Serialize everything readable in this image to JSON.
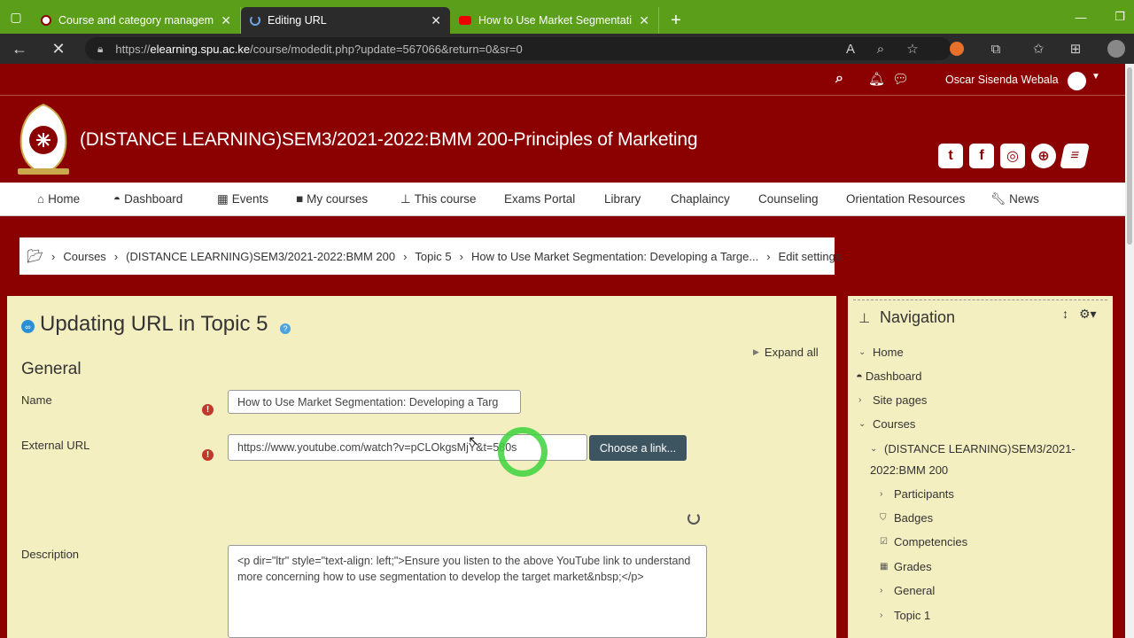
{
  "browser": {
    "tabs": [
      {
        "label": "Course and category manageme",
        "icon": "spu-favicon"
      },
      {
        "label": "Editing URL",
        "icon": "loading-icon"
      },
      {
        "label": "How to Use Market Segmentatio",
        "icon": "youtube-icon"
      }
    ],
    "url_prefix": "https://",
    "url_domain": "elearning.spu.ac.ke",
    "url_path": "/course/modedit.php?update=567066&return=0&sr=0"
  },
  "topnav": {
    "user_name": "Oscar Sisenda Webala"
  },
  "header": {
    "course_title": "(DISTANCE LEARNING)SEM3/2021-2022:BMM 200-Principles of Marketing"
  },
  "menu": [
    {
      "label": "Home",
      "icon": "home-icon"
    },
    {
      "label": "Dashboard",
      "icon": "dashboard-icon"
    },
    {
      "label": "Events",
      "icon": "calendar-icon"
    },
    {
      "label": "My courses",
      "icon": "briefcase-icon"
    },
    {
      "label": "This course",
      "icon": "sitemap-icon"
    },
    {
      "label": "Exams Portal"
    },
    {
      "label": "Library"
    },
    {
      "label": "Chaplaincy"
    },
    {
      "label": "Counseling"
    },
    {
      "label": "Orientation Resources"
    },
    {
      "label": "News",
      "icon": "wrench-icon"
    }
  ],
  "breadcrumb": [
    "Courses",
    "(DISTANCE LEARNING)SEM3/2021-2022:BMM 200",
    "Topic 5",
    "How to Use Market Segmentation: Developing a Targe...",
    "Edit settings"
  ],
  "form": {
    "page_heading": "Updating URL in Topic 5",
    "expand_all": "Expand all",
    "section_general": "General",
    "name_label": "Name",
    "name_value": "How to Use Market Segmentation: Developing a Targ",
    "url_label": "External URL",
    "url_value": "https://www.youtube.com/watch?v=pCLOkgsMjY&t=580s",
    "choose_link": "Choose a link...",
    "description_label": "Description",
    "description_value": "<p dir=\"ltr\" style=\"text-align: left;\">Ensure you listen to the above YouTube link to understand more concerning how to use segmentation to develop the target market&nbsp;</p>"
  },
  "navigation": {
    "title": "Navigation",
    "items": [
      {
        "label": "Home"
      },
      {
        "label": "Dashboard"
      },
      {
        "label": "Site pages"
      },
      {
        "label": "Courses"
      },
      {
        "label": "(DISTANCE LEARNING)SEM3/2021-"
      },
      {
        "label": "2022:BMM 200"
      },
      {
        "label": "Participants"
      },
      {
        "label": "Badges"
      },
      {
        "label": "Competencies"
      },
      {
        "label": "Grades"
      },
      {
        "label": "General"
      },
      {
        "label": "Topic 1"
      }
    ]
  },
  "colors": {
    "brand": "#8b0000",
    "tabbar": "#5a9e1a",
    "block_bg": "#f4efc1"
  }
}
